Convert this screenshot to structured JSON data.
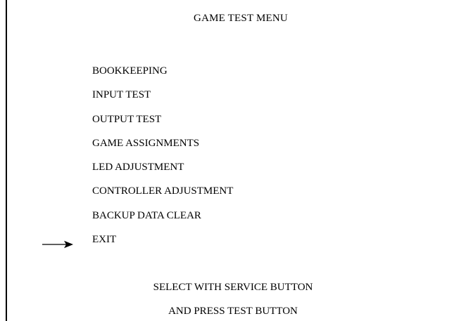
{
  "screen": {
    "title": "GAME TEST MENU",
    "menu": {
      "items": [
        {
          "label": "BOOKKEEPING"
        },
        {
          "label": "INPUT TEST"
        },
        {
          "label": "OUTPUT TEST"
        },
        {
          "label": "GAME ASSIGNMENTS"
        },
        {
          "label": "LED ADJUSTMENT"
        },
        {
          "label": "CONTROLLER ADJUSTMENT"
        },
        {
          "label": "BACKUP DATA CLEAR"
        },
        {
          "label": "EXIT"
        }
      ],
      "selected_label": "EXIT",
      "cursor_icon": "right-arrow-icon"
    },
    "footer": {
      "line1": "SELECT WITH SERVICE BUTTON",
      "line2": "AND PRESS TEST BUTTON"
    }
  }
}
